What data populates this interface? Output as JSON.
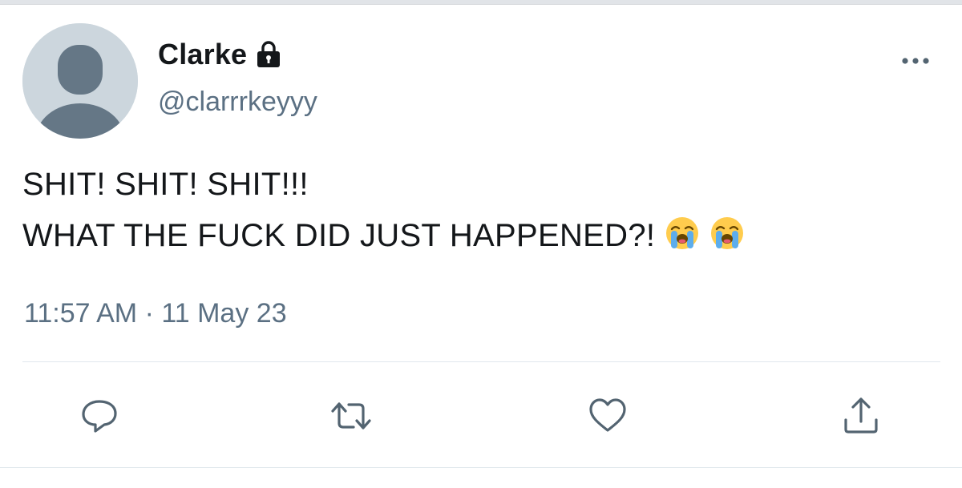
{
  "user": {
    "display_name": "Clarke",
    "handle": "@clarrrkeyyy",
    "protected_icon": "lock-icon",
    "avatar": "default-avatar"
  },
  "tweet": {
    "lines": [
      "SHIT! SHIT! SHIT!!!",
      "WHAT THE FUCK DID JUST HAPPENED?!"
    ],
    "emojis": [
      "loudly-crying-face",
      "loudly-crying-face"
    ],
    "time": "11:57 AM",
    "separator": " · ",
    "date": "11 May 23"
  },
  "actions": [
    {
      "name": "reply",
      "icon": "reply-icon"
    },
    {
      "name": "retweet",
      "icon": "retweet-icon"
    },
    {
      "name": "like",
      "icon": "heart-icon"
    },
    {
      "name": "share",
      "icon": "share-icon"
    }
  ],
  "menu_icon": "more-options-icon",
  "colors": {
    "text_primary": "#14171a",
    "text_secondary": "#5b7083",
    "icon": "#536471",
    "divider": "#e1e8ed",
    "avatar_bg": "#ccd6dd",
    "avatar_fg": "#657786"
  }
}
